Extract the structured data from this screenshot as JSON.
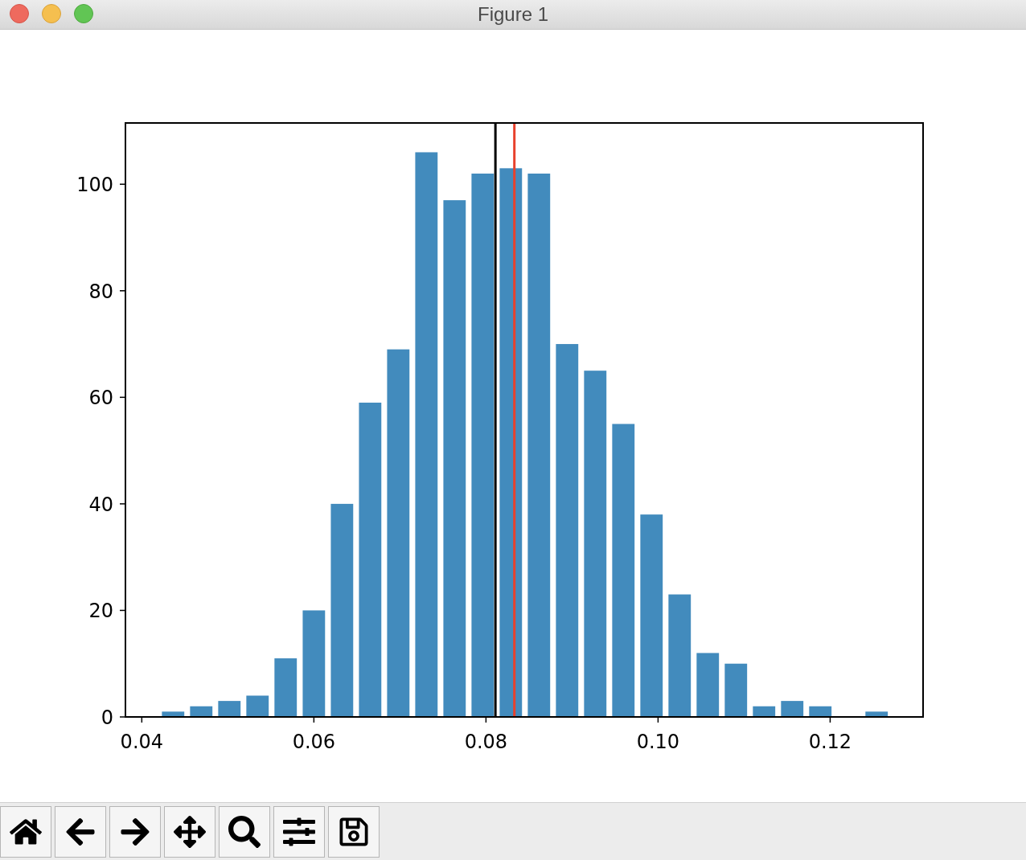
{
  "window": {
    "title": "Figure 1"
  },
  "figure": {
    "chart_data": {
      "type": "bar",
      "x": [
        0.04364,
        0.04691,
        0.05018,
        0.05345,
        0.05672,
        0.06,
        0.06327,
        0.06654,
        0.06981,
        0.07308,
        0.07635,
        0.07962,
        0.08289,
        0.08616,
        0.08943,
        0.0927,
        0.09597,
        0.09924,
        0.10251,
        0.10578,
        0.10905,
        0.11232,
        0.11559,
        0.11886,
        0.12213,
        0.1254
      ],
      "series": [
        {
          "color": "#428bbd",
          "values": [
            1,
            2,
            3,
            4,
            11,
            20,
            40,
            59,
            69,
            106,
            97,
            102,
            103,
            102,
            70,
            65,
            55,
            38,
            23,
            12,
            10,
            2,
            3,
            2,
            0,
            1
          ]
        }
      ],
      "xlim": [
        0.0381,
        0.1308
      ],
      "ylim": [
        0,
        111.5
      ],
      "xticks": [
        {
          "value": 0.04,
          "label": "0.04"
        },
        {
          "value": 0.06,
          "label": "0.06"
        },
        {
          "value": 0.08,
          "label": "0.08"
        },
        {
          "value": 0.1,
          "label": "0.10"
        },
        {
          "value": 0.12,
          "label": "0.12"
        }
      ],
      "yticks": [
        0,
        20,
        40,
        60,
        80,
        100
      ],
      "ref_lines": [
        {
          "axis": "x",
          "value": 0.0811,
          "color": "#000000"
        },
        {
          "axis": "x",
          "value": 0.0833,
          "color": "#e8412c"
        }
      ]
    }
  }
}
